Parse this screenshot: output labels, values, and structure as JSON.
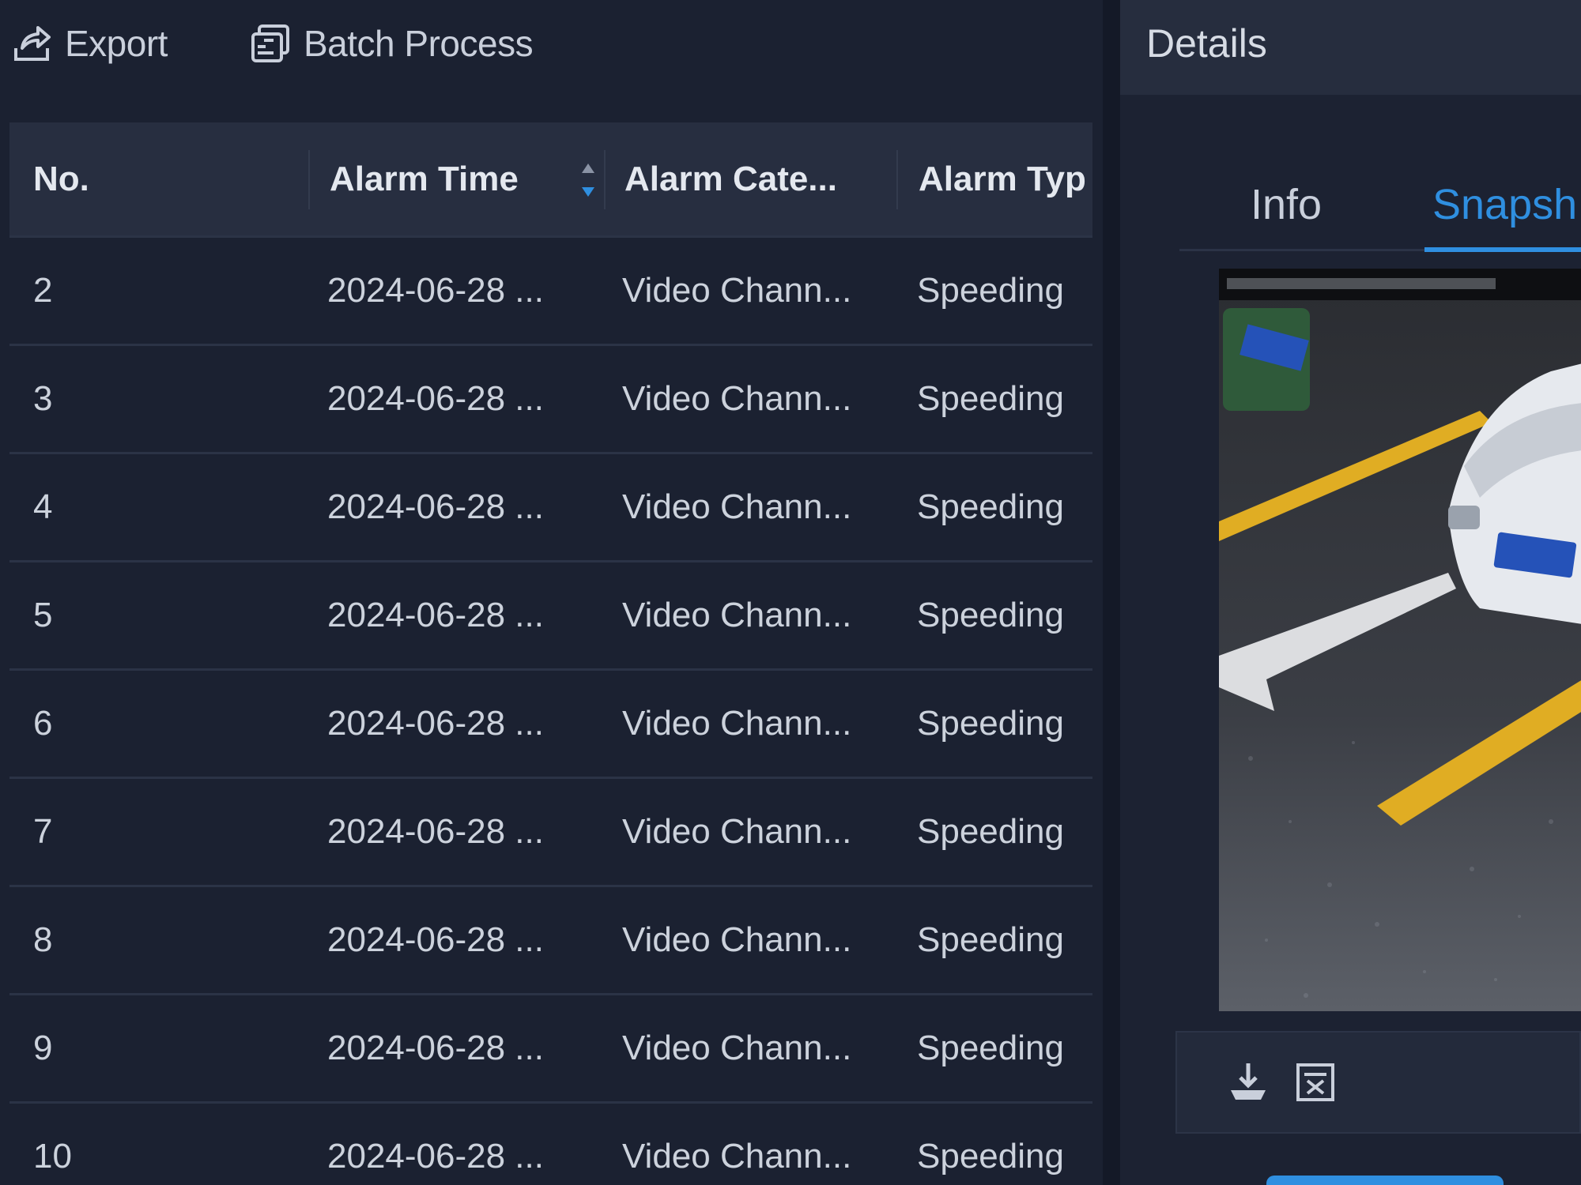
{
  "toolbar": {
    "export_label": "Export",
    "batch_label": "Batch Process"
  },
  "table": {
    "columns": [
      "No.",
      "Alarm Time",
      "Alarm Cate...",
      "Alarm Typ"
    ],
    "rows": [
      {
        "no": "2",
        "time": "2024-06-28 ...",
        "category": "Video Chann...",
        "type": "Speeding"
      },
      {
        "no": "3",
        "time": "2024-06-28 ...",
        "category": "Video Chann...",
        "type": "Speeding"
      },
      {
        "no": "4",
        "time": "2024-06-28 ...",
        "category": "Video Chann...",
        "type": "Speeding"
      },
      {
        "no": "5",
        "time": "2024-06-28 ...",
        "category": "Video Chann...",
        "type": "Speeding"
      },
      {
        "no": "6",
        "time": "2024-06-28 ...",
        "category": "Video Chann...",
        "type": "Speeding"
      },
      {
        "no": "7",
        "time": "2024-06-28 ...",
        "category": "Video Chann...",
        "type": "Speeding"
      },
      {
        "no": "8",
        "time": "2024-06-28 ...",
        "category": "Video Chann...",
        "type": "Speeding"
      },
      {
        "no": "9",
        "time": "2024-06-28 ...",
        "category": "Video Chann...",
        "type": "Speeding"
      },
      {
        "no": "10",
        "time": "2024-06-28 ...",
        "category": "Video Chann...",
        "type": "Speeding"
      }
    ]
  },
  "details": {
    "title": "Details",
    "tabs": [
      "Info",
      "Snapsh"
    ],
    "active_tab": "Snapsh"
  },
  "icons": {
    "export": "export-icon",
    "batch": "batch-process-icon",
    "sort": "sort-icon",
    "download": "download-icon",
    "extra": "image-action-icon"
  },
  "colors": {
    "background": "#1b2131",
    "header": "#272e40",
    "accent": "#2f8fe0",
    "text": "#ccd2dc"
  }
}
